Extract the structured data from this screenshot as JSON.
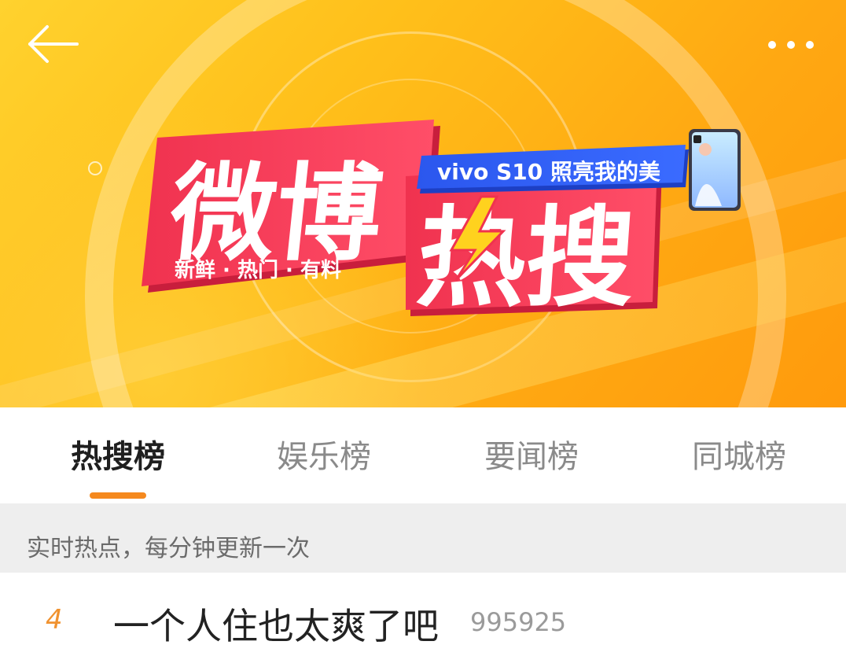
{
  "header": {
    "back_icon": "back-arrow-icon",
    "more_icon": "more-dots-icon"
  },
  "banner": {
    "title_line1": "微博",
    "title_line2": "热搜",
    "tagline": "新鲜 · 热门 · 有料",
    "sponsor": "vivo S10 照亮我的美",
    "lightning_icon": "lightning-icon",
    "phone_icon": "phone-image-icon",
    "colors": {
      "background": "#ffb81c",
      "logo_red": "#f0324f",
      "sponsor_blue": "#2f5cf0",
      "lightning": "#ffd21e"
    }
  },
  "tabs": [
    {
      "label": "热搜榜",
      "active": true
    },
    {
      "label": "娱乐榜",
      "active": false
    },
    {
      "label": "要闻榜",
      "active": false
    },
    {
      "label": "同城榜",
      "active": false
    }
  ],
  "tab_accent": "#f5891e",
  "notice": {
    "text": "实时热点，每分钟更新一次"
  },
  "list": [
    {
      "rank": "4",
      "title": "一个人住也太爽了吧",
      "count": "995925"
    }
  ]
}
